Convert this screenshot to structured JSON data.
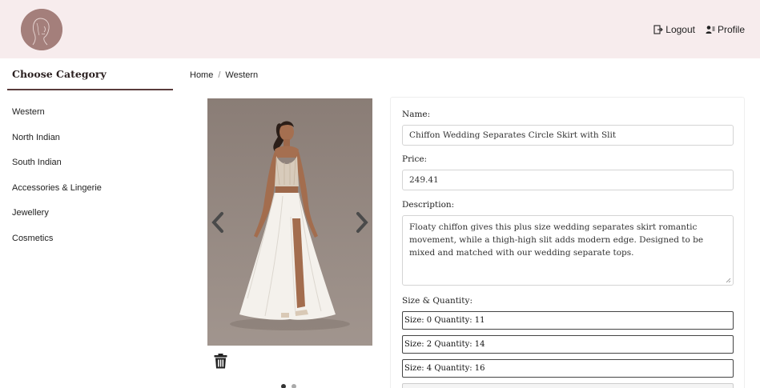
{
  "header": {
    "logout_label": "Logout",
    "profile_label": "Profile"
  },
  "sidebar": {
    "title": "Choose Category",
    "items": [
      {
        "label": "Western"
      },
      {
        "label": "North Indian"
      },
      {
        "label": "South Indian"
      },
      {
        "label": "Accessories & Lingerie"
      },
      {
        "label": "Jewellery"
      },
      {
        "label": "Cosmetics"
      }
    ]
  },
  "breadcrumb": {
    "home": "Home",
    "separator": "/",
    "current": "Western"
  },
  "product": {
    "name_label": "Name:",
    "name_value": "Chiffon Wedding Separates Circle Skirt with Slit",
    "price_label": "Price:",
    "price_value": "249.41",
    "description_label": "Description:",
    "description_value": "Floaty chiffon gives this plus size wedding separates skirt romantic movement, while a thigh-high slit adds modern edge. Designed to be mixed and matched with our wedding separate tops.",
    "size_quantity_label": "Size & Quantity:",
    "sizes": [
      {
        "text": "Size: 0 Quantity: 11"
      },
      {
        "text": "Size: 2 Quantity: 14"
      },
      {
        "text": "Size: 4 Quantity: 16"
      }
    ]
  },
  "carousel": {
    "slide_count": 2,
    "active_index": 0
  },
  "icons": {
    "logout": "logout-icon",
    "profile": "profile-icon",
    "prev": "chevron-left-icon",
    "next": "chevron-right-icon",
    "delete": "trash-icon"
  },
  "colors": {
    "header_bg": "#f7eced",
    "logo_bg": "#a47f7b",
    "accent_rule": "#5a3b3b"
  }
}
